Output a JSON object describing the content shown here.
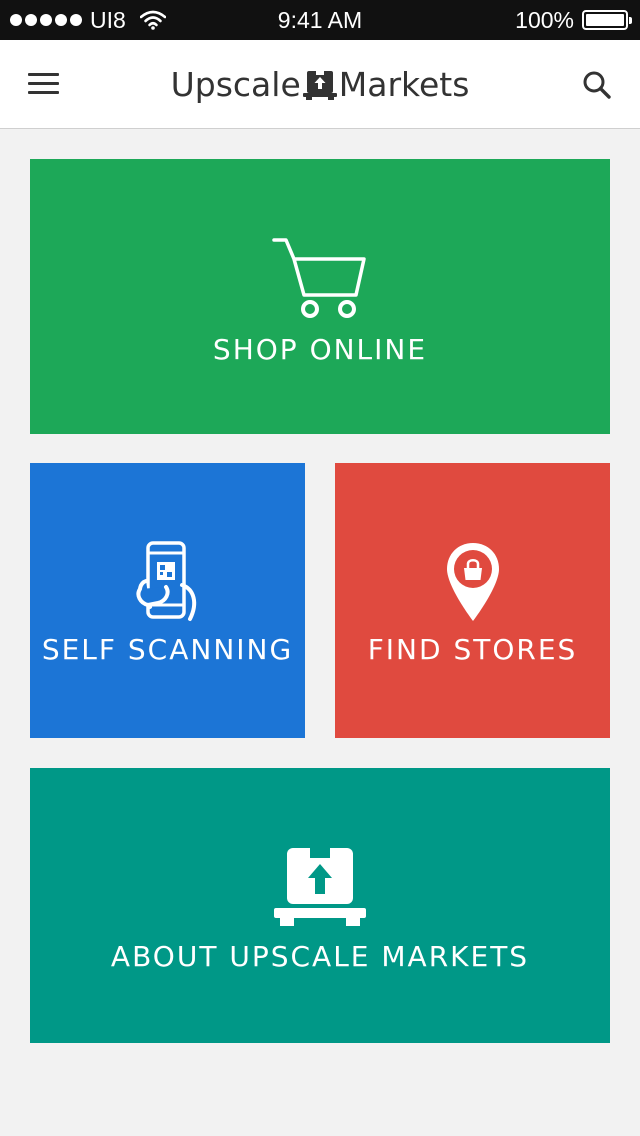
{
  "status_bar": {
    "carrier": "UI8",
    "time": "9:41 AM",
    "battery": "100%",
    "battery_level": 1.0,
    "signal_bars": 5
  },
  "header": {
    "title_left": "Upscale",
    "title_right": "Markets",
    "menu_icon": "hamburger-menu-icon",
    "search_icon": "search-icon",
    "logo_icon": "box-on-pallet-icon"
  },
  "tiles": [
    {
      "label": "SHOP ONLINE",
      "icon": "shopping-cart-icon",
      "color": "#1da858"
    },
    {
      "label": "SELF SCANNING",
      "icon": "phone-qr-scan-icon",
      "color": "#1c75d6"
    },
    {
      "label": "FIND STORES",
      "icon": "map-pin-bag-icon",
      "color": "#e04a3f"
    },
    {
      "label": "ABOUT UPSCALE MARKETS",
      "icon": "box-on-pallet-icon",
      "color": "#009887"
    }
  ],
  "colors": {
    "background": "#f2f2f2",
    "status_bar": "#111111",
    "header_text": "#333333"
  }
}
